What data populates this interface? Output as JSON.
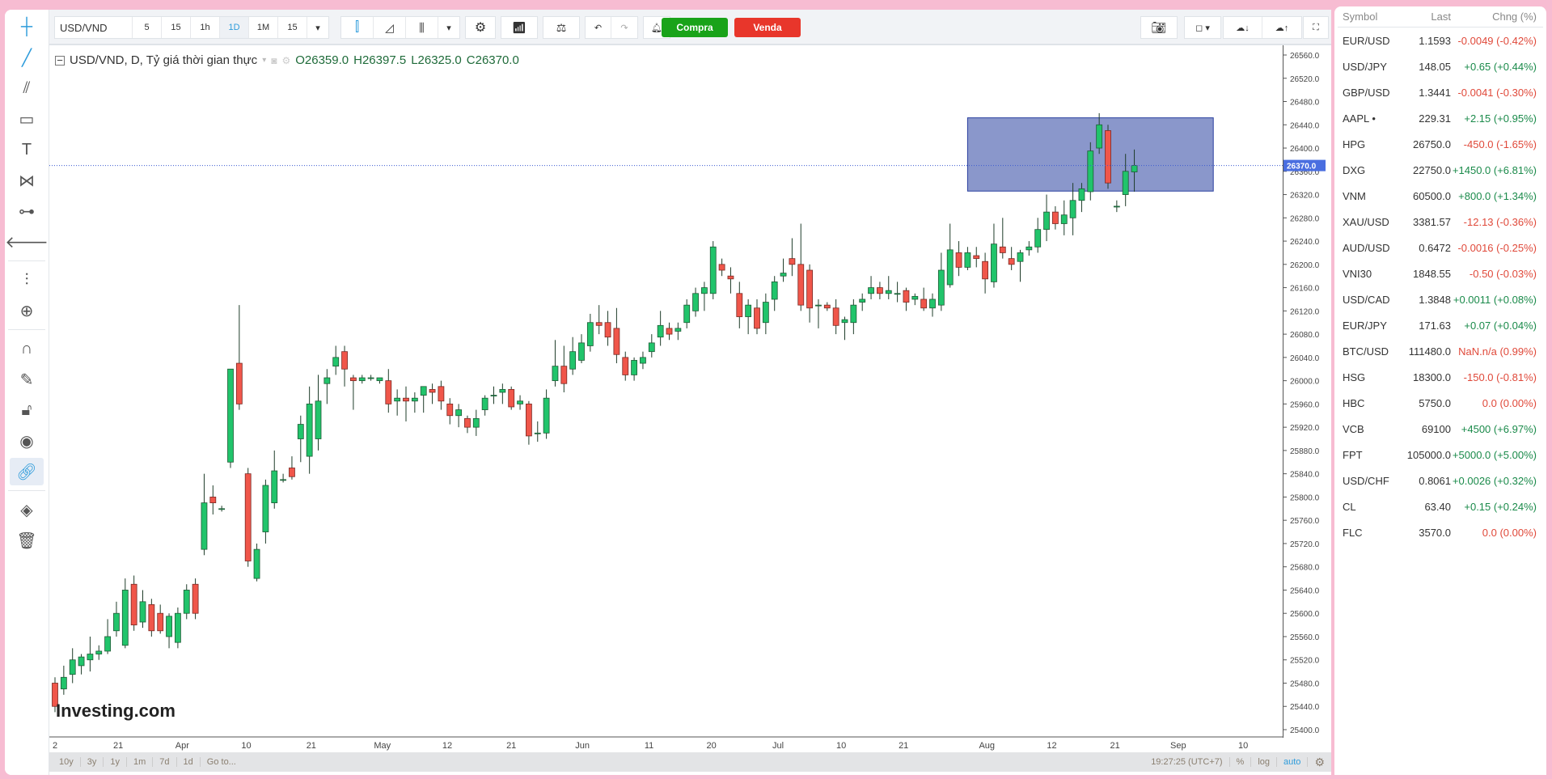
{
  "toolbar": {
    "symbol": "USD/VND",
    "intervals": [
      "5",
      "15",
      "1h",
      "1D",
      "1M",
      "15"
    ],
    "active_interval": "1D",
    "buy_label": "Compra",
    "sell_label": "Venda",
    "buy_color": "#19a319",
    "sell_color": "#e8362b"
  },
  "legend": {
    "title": "USD/VND, D, Tỷ giá thời gian thực",
    "open": "O26359.0",
    "high": "H26397.5",
    "low": "L26325.0",
    "close": "C26370.0"
  },
  "price_label": "26370.0",
  "bottom": {
    "ranges": [
      "10y",
      "3y",
      "1y",
      "1m",
      "7d",
      "1d",
      "Go to..."
    ],
    "time": "19:27:25 (UTC+7)",
    "percent": "%",
    "log": "log",
    "auto": "auto"
  },
  "watchlist": {
    "headers": [
      "Symbol",
      "Last",
      "Chng (%)"
    ],
    "rows": [
      {
        "symbol": "EUR/USD",
        "last": "1.1593",
        "chg": "-0.0049 (-0.42%)",
        "dir": "dn"
      },
      {
        "symbol": "USD/JPY",
        "last": "148.05",
        "chg": "+0.65 (+0.44%)",
        "dir": "up"
      },
      {
        "symbol": "GBP/USD",
        "last": "1.3441",
        "chg": "-0.0041 (-0.30%)",
        "dir": "dn"
      },
      {
        "symbol": "AAPL •",
        "last": "229.31",
        "chg": "+2.15 (+0.95%)",
        "dir": "up"
      },
      {
        "symbol": "HPG",
        "last": "26750.0",
        "chg": "-450.0 (-1.65%)",
        "dir": "dn"
      },
      {
        "symbol": "DXG",
        "last": "22750.0",
        "chg": "+1450.0 (+6.81%)",
        "dir": "up"
      },
      {
        "symbol": "VNM",
        "last": "60500.0",
        "chg": "+800.0 (+1.34%)",
        "dir": "up"
      },
      {
        "symbol": "XAU/USD",
        "last": "3381.57",
        "chg": "-12.13 (-0.36%)",
        "dir": "dn"
      },
      {
        "symbol": "AUD/USD",
        "last": "0.6472",
        "chg": "-0.0016 (-0.25%)",
        "dir": "dn"
      },
      {
        "symbol": "VNI30",
        "last": "1848.55",
        "chg": "-0.50 (-0.03%)",
        "dir": "dn"
      },
      {
        "symbol": "USD/CAD",
        "last": "1.3848",
        "chg": "+0.0011 (+0.08%)",
        "dir": "up"
      },
      {
        "symbol": "EUR/JPY",
        "last": "171.63",
        "chg": "+0.07 (+0.04%)",
        "dir": "up"
      },
      {
        "symbol": "BTC/USD",
        "last": "111480.0",
        "chg": "NaN.n/a (0.99%)",
        "dir": "dn"
      },
      {
        "symbol": "HSG",
        "last": "18300.0",
        "chg": "-150.0 (-0.81%)",
        "dir": "dn"
      },
      {
        "symbol": "HBC",
        "last": "5750.0",
        "chg": "0.0 (0.00%)",
        "dir": "dn"
      },
      {
        "symbol": "VCB",
        "last": "69100",
        "chg": "+4500 (+6.97%)",
        "dir": "up"
      },
      {
        "symbol": "FPT",
        "last": "105000.0",
        "chg": "+5000.0 (+5.00%)",
        "dir": "up"
      },
      {
        "symbol": "USD/CHF",
        "last": "0.8061",
        "chg": "+0.0026 (+0.32%)",
        "dir": "up"
      },
      {
        "symbol": "CL",
        "last": "63.40",
        "chg": "+0.15 (+0.24%)",
        "dir": "up"
      },
      {
        "symbol": "FLC",
        "last": "3570.0",
        "chg": "0.0 (0.00%)",
        "dir": "dn"
      }
    ]
  },
  "chart_data": {
    "type": "candlestick",
    "ylim": [
      25400,
      26560
    ],
    "ytick_step": 40,
    "up_color": "#21c46b",
    "down_color": "#f0564a",
    "xticks": [
      {
        "label": "2",
        "bar": 0
      },
      {
        "label": "21",
        "bar": 7.2
      },
      {
        "label": "Apr",
        "bar": 14.5
      },
      {
        "label": "10",
        "bar": 21.8
      },
      {
        "label": "21",
        "bar": 29.2
      },
      {
        "label": "May",
        "bar": 37.3
      },
      {
        "label": "12",
        "bar": 44.7
      },
      {
        "label": "21",
        "bar": 52
      },
      {
        "label": "Jun",
        "bar": 60.1
      },
      {
        "label": "11",
        "bar": 67.7
      },
      {
        "label": "20",
        "bar": 74.8
      },
      {
        "label": "Jul",
        "bar": 82.4
      },
      {
        "label": "10",
        "bar": 89.6
      },
      {
        "label": "21",
        "bar": 96.7
      },
      {
        "label": "Aug",
        "bar": 106.2
      },
      {
        "label": "12",
        "bar": 113.6
      },
      {
        "label": "21",
        "bar": 120.8
      },
      {
        "label": "Sep",
        "bar": 128
      },
      {
        "label": "10",
        "bar": 135.4
      }
    ],
    "last_price": 26370,
    "rectangle": {
      "bar_start": 104,
      "bar_end": 132,
      "price_top": 26452,
      "price_bottom": 26326
    },
    "watermark": "Investing.com",
    "ohlc": [
      [
        25480,
        25490,
        25430,
        25440
      ],
      [
        25470,
        25510,
        25460,
        25490
      ],
      [
        25495,
        25540,
        25480,
        25520
      ],
      [
        25510,
        25530,
        25495,
        25525
      ],
      [
        25520,
        25560,
        25500,
        25530
      ],
      [
        25530,
        25545,
        25520,
        25535
      ],
      [
        25535,
        25590,
        25530,
        25560
      ],
      [
        25570,
        25620,
        25560,
        25600
      ],
      [
        25545,
        25660,
        25540,
        25640
      ],
      [
        25650,
        25665,
        25570,
        25580
      ],
      [
        25585,
        25640,
        25575,
        25620
      ],
      [
        25615,
        25625,
        25560,
        25570
      ],
      [
        25600,
        25615,
        25565,
        25570
      ],
      [
        25560,
        25600,
        25540,
        25595
      ],
      [
        25550,
        25610,
        25540,
        25600
      ],
      [
        25600,
        25650,
        25590,
        25640
      ],
      [
        25650,
        25660,
        25590,
        25600
      ],
      [
        25710,
        25840,
        25700,
        25790
      ],
      [
        25800,
        25820,
        25770,
        25790
      ],
      [
        25780,
        25785,
        25775,
        25780
      ],
      [
        25860,
        26020,
        25850,
        26020
      ],
      [
        26030,
        26130,
        25950,
        25960
      ],
      [
        25840,
        25850,
        25680,
        25690
      ],
      [
        25660,
        25720,
        25655,
        25710
      ],
      [
        25740,
        25830,
        25720,
        25820
      ],
      [
        25790,
        25880,
        25780,
        25845
      ],
      [
        25830,
        25840,
        25825,
        25830
      ],
      [
        25850,
        25870,
        25830,
        25835
      ],
      [
        25900,
        25940,
        25860,
        25925
      ],
      [
        25870,
        25990,
        25840,
        25960
      ],
      [
        25900,
        26010,
        25880,
        25965
      ],
      [
        25995,
        26020,
        25960,
        26005
      ],
      [
        26025,
        26060,
        26010,
        26040
      ],
      [
        26050,
        26060,
        25990,
        26020
      ],
      [
        26005,
        26010,
        25950,
        26000
      ],
      [
        26000,
        26010,
        25995,
        26005
      ],
      [
        26005,
        26010,
        26000,
        26005
      ],
      [
        26000,
        26005,
        25995,
        26005
      ],
      [
        26000,
        26020,
        25945,
        25960
      ],
      [
        25965,
        25985,
        25940,
        25970
      ],
      [
        25970,
        25990,
        25930,
        25965
      ],
      [
        25965,
        25980,
        25945,
        25970
      ],
      [
        25975,
        25990,
        25945,
        25990
      ],
      [
        25985,
        25995,
        25960,
        25980
      ],
      [
        25990,
        26000,
        25950,
        25965
      ],
      [
        25960,
        25970,
        25925,
        25940
      ],
      [
        25940,
        25960,
        25920,
        25950
      ],
      [
        25935,
        25940,
        25910,
        25920
      ],
      [
        25920,
        25950,
        25905,
        25935
      ],
      [
        25950,
        25975,
        25940,
        25970
      ],
      [
        25975,
        25990,
        25960,
        25975
      ],
      [
        25980,
        25995,
        25960,
        25985
      ],
      [
        25985,
        25990,
        25950,
        25955
      ],
      [
        25960,
        25975,
        25950,
        25965
      ],
      [
        25960,
        25965,
        25890,
        25905
      ],
      [
        25910,
        25930,
        25895,
        25910
      ],
      [
        25910,
        25985,
        25900,
        25970
      ],
      [
        26000,
        26070,
        25990,
        26025
      ],
      [
        26025,
        26060,
        25980,
        25995
      ],
      [
        26020,
        26075,
        26010,
        26050
      ],
      [
        26035,
        26080,
        26030,
        26065
      ],
      [
        26060,
        26115,
        26050,
        26100
      ],
      [
        26100,
        26130,
        26080,
        26095
      ],
      [
        26100,
        26120,
        26060,
        26075
      ],
      [
        26090,
        26125,
        26030,
        26045
      ],
      [
        26040,
        26050,
        26000,
        26010
      ],
      [
        26010,
        26040,
        26000,
        26035
      ],
      [
        26030,
        26050,
        26020,
        26040
      ],
      [
        26050,
        26080,
        26040,
        26065
      ],
      [
        26075,
        26120,
        26060,
        26095
      ],
      [
        26090,
        26100,
        26070,
        26080
      ],
      [
        26085,
        26100,
        26070,
        26090
      ],
      [
        26100,
        26140,
        26090,
        26130
      ],
      [
        26120,
        26160,
        26110,
        26150
      ],
      [
        26150,
        26170,
        26120,
        26160
      ],
      [
        26150,
        26240,
        26140,
        26230
      ],
      [
        26200,
        26210,
        26180,
        26190
      ],
      [
        26180,
        26195,
        26150,
        26175
      ],
      [
        26150,
        26170,
        26090,
        26110
      ],
      [
        26110,
        26140,
        26080,
        26130
      ],
      [
        26125,
        26140,
        26080,
        26090
      ],
      [
        26100,
        26150,
        26080,
        26135
      ],
      [
        26140,
        26180,
        26120,
        26170
      ],
      [
        26180,
        26210,
        26170,
        26185
      ],
      [
        26210,
        26245,
        26180,
        26200
      ],
      [
        26200,
        26270,
        26120,
        26130
      ],
      [
        26190,
        26200,
        26100,
        26125
      ],
      [
        26130,
        26140,
        26090,
        26130
      ],
      [
        26130,
        26135,
        26120,
        26125
      ],
      [
        26125,
        26140,
        26080,
        26095
      ],
      [
        26100,
        26110,
        26070,
        26105
      ],
      [
        26100,
        26140,
        26080,
        26130
      ],
      [
        26135,
        26150,
        26120,
        26140
      ],
      [
        26150,
        26180,
        26140,
        26160
      ],
      [
        26160,
        26170,
        26140,
        26150
      ],
      [
        26150,
        26180,
        26140,
        26155
      ],
      [
        26150,
        26170,
        26135,
        26150
      ],
      [
        26155,
        26160,
        26120,
        26135
      ],
      [
        26140,
        26150,
        26130,
        26145
      ],
      [
        26140,
        26160,
        26120,
        26125
      ],
      [
        26125,
        26150,
        26110,
        26140
      ],
      [
        26130,
        26220,
        26120,
        26190
      ],
      [
        26165,
        26270,
        26160,
        26225
      ],
      [
        26220,
        26240,
        26180,
        26195
      ],
      [
        26195,
        26230,
        26190,
        26220
      ],
      [
        26215,
        26230,
        26195,
        26210
      ],
      [
        26205,
        26220,
        26150,
        26175
      ],
      [
        26170,
        26270,
        26160,
        26235
      ],
      [
        26230,
        26280,
        26210,
        26220
      ],
      [
        26210,
        26230,
        26190,
        26200
      ],
      [
        26205,
        26225,
        26170,
        26220
      ],
      [
        26225,
        26240,
        26215,
        26230
      ],
      [
        26230,
        26280,
        26220,
        26260
      ],
      [
        26260,
        26320,
        26240,
        26290
      ],
      [
        26290,
        26300,
        26260,
        26270
      ],
      [
        26270,
        26310,
        26250,
        26285
      ],
      [
        26280,
        26340,
        26250,
        26310
      ],
      [
        26310,
        26340,
        26290,
        26330
      ],
      [
        26325,
        26410,
        26310,
        26395
      ],
      [
        26400,
        26460,
        26390,
        26440
      ],
      [
        26430,
        26440,
        26330,
        26340
      ],
      [
        26300,
        26310,
        26290,
        26300
      ],
      [
        26320,
        26390,
        26300,
        26360
      ],
      [
        26359,
        26397.5,
        26325,
        26370
      ]
    ]
  }
}
